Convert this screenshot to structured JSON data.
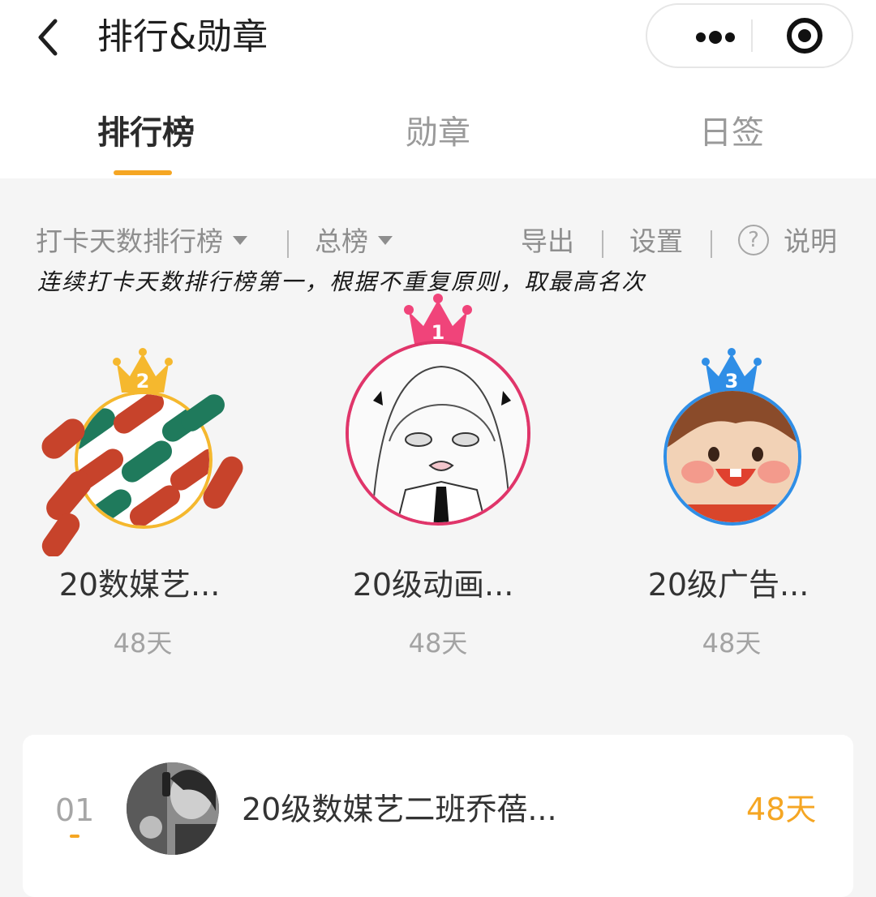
{
  "header": {
    "title": "排行&勋章",
    "capsule": {
      "more_icon": "more-dots-icon",
      "close_icon": "target-icon"
    }
  },
  "tabs": [
    {
      "label": "排行榜",
      "active": true
    },
    {
      "label": "勋章",
      "active": false
    },
    {
      "label": "日签",
      "active": false
    }
  ],
  "filters": {
    "ranking_type": "打卡天数排行榜",
    "scope": "总榜",
    "export": "导出",
    "settings": "设置",
    "help": "说明",
    "help_icon_glyph": "?"
  },
  "note": "连续打卡天数排行榜第一，根据不重复原则，取最高名次",
  "podium": [
    {
      "rank": "1",
      "name": "20级动画...",
      "days": "48天",
      "color": "#f0447a"
    },
    {
      "rank": "2",
      "name": "20数媒艺...",
      "days": "48天",
      "color": "#f5b82e"
    },
    {
      "rank": "3",
      "name": "20级广告...",
      "days": "48天",
      "color": "#2f8ee6"
    }
  ],
  "list": [
    {
      "rank": "01",
      "name": "20级数媒艺二班乔蓓...",
      "days": "48天"
    }
  ],
  "colors": {
    "accent": "#f5a623",
    "background": "#f5f5f5"
  }
}
